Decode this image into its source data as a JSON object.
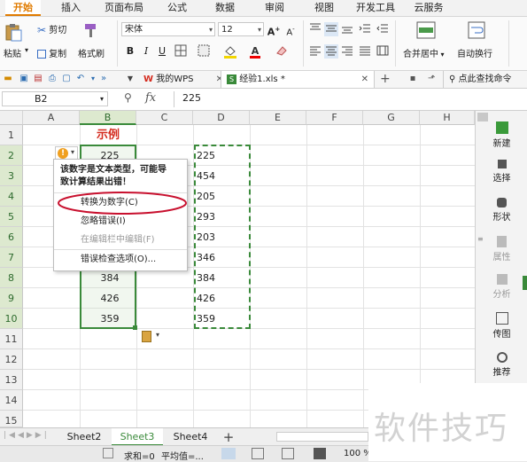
{
  "menu_tabs": [
    "开始",
    "插入",
    "页面布局",
    "公式",
    "数据",
    "审阅",
    "视图",
    "开发工具",
    "云服务"
  ],
  "ribbon": {
    "paste": "粘贴",
    "cut": "剪切",
    "copy": "复制",
    "format_painter": "格式刷",
    "font_name": "宋体",
    "font_size": "12",
    "bold": "B",
    "italic": "I",
    "underline": "U",
    "merge_center": "合并居中",
    "wrap_text": "自动换行"
  },
  "doc_tabs": {
    "wps_tab": "我的WPS",
    "file_tab": "经验1.xls *",
    "search_label": "点此查找命令"
  },
  "formula_bar": {
    "cell_ref": "B2",
    "fx": "fx",
    "value": "225"
  },
  "columns": [
    "A",
    "B",
    "C",
    "D",
    "E",
    "F",
    "G",
    "H"
  ],
  "rows": [
    "1",
    "2",
    "3",
    "4",
    "5",
    "6",
    "7",
    "8",
    "9",
    "10",
    "11",
    "12",
    "13",
    "14",
    "15"
  ],
  "cells": {
    "b1": "示例",
    "b2": "225",
    "b8": "384",
    "b9": "426",
    "b10": "359",
    "d": [
      "225",
      "454",
      "205",
      "293",
      "203",
      "346",
      "384",
      "426",
      "359"
    ]
  },
  "error_popup": {
    "message_line1": "该数字是文本类型，可能导",
    "message_line2": "致计算结果出错！",
    "items": [
      "转换为数字(C)",
      "忽略错误(I)",
      "在编辑栏中编辑(F)",
      "错误检查选项(O)..."
    ]
  },
  "right_panel": [
    "新建",
    "选择",
    "形状",
    "属性",
    "分析",
    "传图",
    "推荐"
  ],
  "sheet_tabs": [
    "Sheet2",
    "Sheet3",
    "Sheet4"
  ],
  "add_sheet": "+",
  "status": {
    "sum": "求和=0",
    "avg": "平均值=...",
    "zoom": "100 %"
  },
  "watermark": "软件技巧",
  "colors": {
    "accent_orange": "#e07b00",
    "selection_green": "#3a8a3a",
    "title_red": "#d42b1e",
    "highlight_ellipse": "#c8102e"
  }
}
